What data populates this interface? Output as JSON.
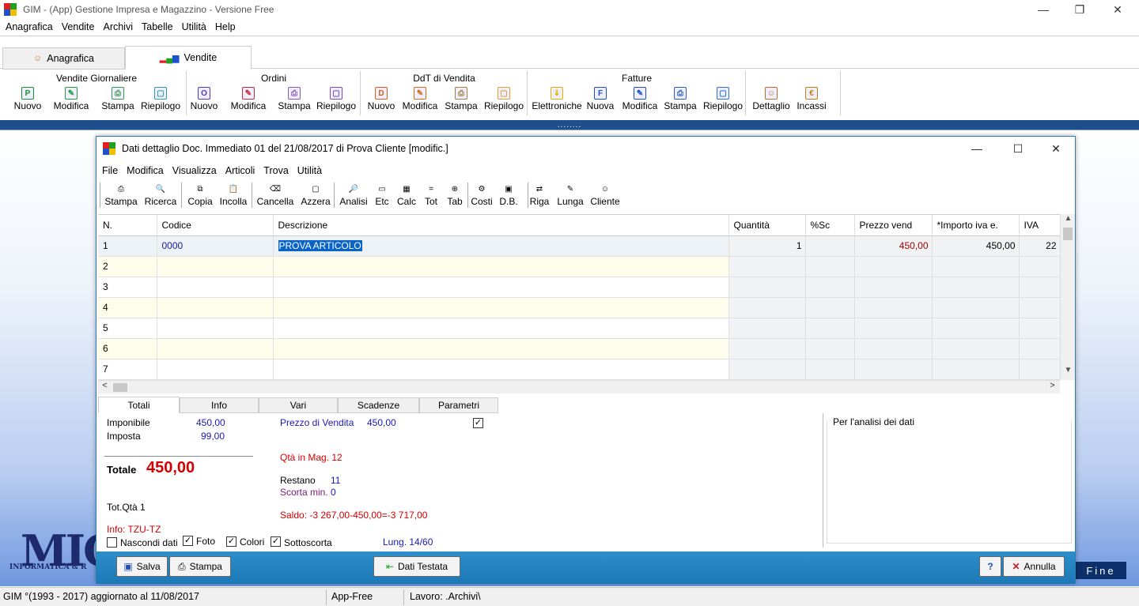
{
  "window": {
    "title": "GIM  - (App) Gestione Impresa e Magazzino - Versione Free",
    "minimize": "—",
    "restore": "❐",
    "close": "✕"
  },
  "menubar": [
    "Anagrafica",
    "Vendite",
    "Archivi",
    "Tabelle",
    "Utilità",
    "Help"
  ],
  "tabs": [
    {
      "label": "Anagrafica",
      "active": false
    },
    {
      "label": "Vendite",
      "active": true
    }
  ],
  "ribbon": {
    "groups": [
      {
        "title": "Vendite Giornaliere",
        "buttons": [
          {
            "label": "Nuovo",
            "glyph": "P",
            "color": "#1a8f2a"
          },
          {
            "label": "Modifica",
            "glyph": "✎",
            "color": "#2a9a3a"
          },
          {
            "label": "Stampa",
            "glyph": "⎙",
            "color": "#3a9a4a"
          },
          {
            "label": "Riepilogo",
            "glyph": "▢",
            "color": "#2aa0a0"
          }
        ]
      },
      {
        "title": "Ordini",
        "buttons": [
          {
            "label": "Nuovo",
            "glyph": "O",
            "color": "#5a3ab0"
          },
          {
            "label": "Modifica",
            "glyph": "✎",
            "color": "#c03030"
          },
          {
            "label": "Stampa",
            "glyph": "⎙",
            "color": "#8a5ab0"
          },
          {
            "label": "Riepilogo",
            "glyph": "▢",
            "color": "#7a4ac0"
          }
        ]
      },
      {
        "title": "DdT di Vendita",
        "buttons": [
          {
            "label": "Nuovo",
            "glyph": "D",
            "color": "#d06010"
          },
          {
            "label": "Modifica",
            "glyph": "✎",
            "color": "#d07010"
          },
          {
            "label": "Stampa",
            "glyph": "⎙",
            "color": "#a08040"
          },
          {
            "label": "Riepilogo",
            "glyph": "▢",
            "color": "#e0a030"
          }
        ]
      },
      {
        "title": "Fatture",
        "buttons": [
          {
            "label": "Elettroniche",
            "glyph": "⇓",
            "color": "#e0b000"
          },
          {
            "label": "Nuova",
            "glyph": "F",
            "color": "#2050c0"
          },
          {
            "label": "Modifica",
            "glyph": "✎",
            "color": "#2050c0"
          },
          {
            "label": "Stampa",
            "glyph": "⎙",
            "color": "#3060b0"
          },
          {
            "label": "Riepilogo",
            "glyph": "▢",
            "color": "#3070d0"
          }
        ]
      },
      {
        "title": "",
        "buttons": [
          {
            "label": "Dettaglio",
            "glyph": "☺",
            "color": "#c07020"
          },
          {
            "label": "Incassi",
            "glyph": "€",
            "color": "#c08010"
          }
        ]
      }
    ]
  },
  "splitter_dots": "........",
  "dialog": {
    "title": "Dati dettaglio Doc. Immediato 01 del 21/08/2017 di Prova Cliente [modific.]",
    "minimize": "—",
    "maximize": "☐",
    "close": "✕",
    "menu": [
      "File",
      "Modifica",
      "Visualizza",
      "Articoli",
      "Trova",
      "Utilità"
    ],
    "toolbar": [
      {
        "label": "Stampa",
        "glyph": "⎙"
      },
      {
        "label": "Ricerca",
        "glyph": "🔍"
      },
      {
        "label": "Copia",
        "glyph": "⧉"
      },
      {
        "label": "Incolla",
        "glyph": "📋"
      },
      {
        "label": "Cancella",
        "glyph": "⌫"
      },
      {
        "label": "Azzera",
        "glyph": "▢"
      },
      {
        "label": "Analisi",
        "glyph": "🔎"
      },
      {
        "label": "Etc",
        "glyph": "▭"
      },
      {
        "label": "Calc",
        "glyph": "▦"
      },
      {
        "label": "Tot",
        "glyph": "="
      },
      {
        "label": "Tab",
        "glyph": "⊕"
      },
      {
        "label": "Costi",
        "glyph": "⚙"
      },
      {
        "label": "D.B.",
        "glyph": "▣"
      },
      {
        "label": "Riga",
        "glyph": "⇄"
      },
      {
        "label": "Lunga",
        "glyph": "✎"
      },
      {
        "label": "Cliente",
        "glyph": "☺"
      }
    ],
    "grid": {
      "columns": [
        "N.",
        "Codice",
        "Descrizione",
        "Quantità",
        "%Sc",
        "Prezzo vend",
        "*Importo iva e.",
        "IVA"
      ],
      "rows": [
        {
          "n": "1",
          "codice": "0000",
          "descrizione": "PROVA ARTICOLO",
          "quantita": "1",
          "sconto": "",
          "prezzo": "450,00",
          "importo": "450,00",
          "iva": "22"
        },
        {
          "n": "2",
          "codice": "",
          "descrizione": "",
          "quantita": "",
          "sconto": "",
          "prezzo": "",
          "importo": "",
          "iva": ""
        },
        {
          "n": "3",
          "codice": "",
          "descrizione": "",
          "quantita": "",
          "sconto": "",
          "prezzo": "",
          "importo": "",
          "iva": ""
        },
        {
          "n": "4",
          "codice": "",
          "descrizione": "",
          "quantita": "",
          "sconto": "",
          "prezzo": "",
          "importo": "",
          "iva": ""
        },
        {
          "n": "5",
          "codice": "",
          "descrizione": "",
          "quantita": "",
          "sconto": "",
          "prezzo": "",
          "importo": "",
          "iva": ""
        },
        {
          "n": "6",
          "codice": "",
          "descrizione": "",
          "quantita": "",
          "sconto": "",
          "prezzo": "",
          "importo": "",
          "iva": ""
        },
        {
          "n": "7",
          "codice": "",
          "descrizione": "",
          "quantita": "",
          "sconto": "",
          "prezzo": "",
          "importo": "",
          "iva": ""
        }
      ]
    },
    "bottom_tabs": [
      "Totali",
      "Info",
      "Vari",
      "Scadenze",
      "Parametri"
    ],
    "totals": {
      "imponibile_label": "Imponibile",
      "imponibile": "450,00",
      "imposta_label": "Imposta",
      "imposta": "99,00",
      "totale_label": "Totale",
      "totale": "450,00",
      "totqta": "Tot.Qtà 1",
      "info": "Info: TZU-TZ",
      "prezzo_vendita_label": "Prezzo di Vendita",
      "prezzo_vendita": "450,00",
      "qta_mag": "Qtà in Mag. 12",
      "restano_label": "Restano",
      "restano": "11",
      "scorta_label": "Scorta min.",
      "scorta": "0",
      "saldo": "Saldo: -3 267,00-450,00=-3 717,00",
      "lung": "Lung. 14/60",
      "checkboxes": [
        {
          "label": "Nascondi dati",
          "checked": false
        },
        {
          "label": "Foto",
          "checked": true
        },
        {
          "label": "Colori",
          "checked": true
        },
        {
          "label": "Sottoscorta",
          "checked": true
        }
      ],
      "param_checked": true
    },
    "analisi_label": "Per l'analisi dei dati",
    "buttons": {
      "salva": "Salva",
      "stampa": "Stampa",
      "dati_testata": "Dati Testata",
      "help": "?",
      "annulla": "Annulla"
    }
  },
  "logo": {
    "text": "MIG",
    "sub": "INFORMATICA & R"
  },
  "fine_button": "Fine",
  "status": {
    "left": "GIM °(1993 - 2017)  aggiornato al 11/08/2017",
    "mode": "App-Free",
    "lavoro": "Lavoro: .Archivi\\"
  }
}
